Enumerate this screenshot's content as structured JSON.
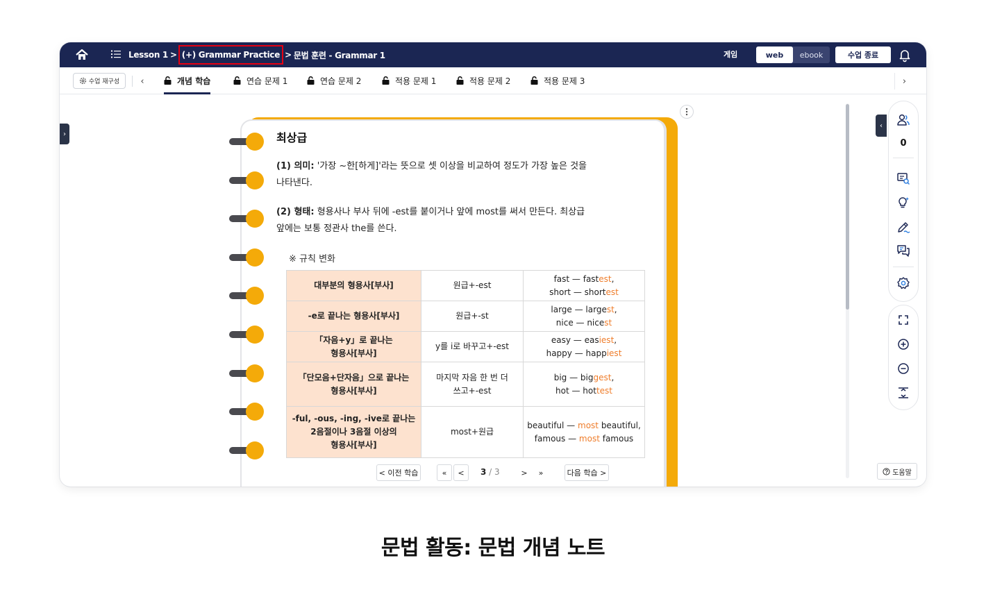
{
  "topbar": {
    "breadcrumb": {
      "lesson": "Lesson 1",
      "sep1": ">",
      "practice": "(+) Grammar Practice",
      "sep2": ">",
      "current": "문법 훈련 - Grammar 1"
    },
    "game_label": "게임",
    "mode_web": "web",
    "mode_ebook": "ebook",
    "end_class": "수업 종료",
    "colors": {
      "bar": "#1b2653",
      "highlight": "#e60012"
    }
  },
  "tabs": {
    "reconfigure": "수업 재구성",
    "items": [
      {
        "label": "개념 학습",
        "active": true
      },
      {
        "label": "연습 문제 1"
      },
      {
        "label": "연습 문제 2"
      },
      {
        "label": "적용 문제 1"
      },
      {
        "label": "적용 문제 2"
      },
      {
        "label": "적용 문제 3"
      }
    ]
  },
  "note": {
    "title": "최상급",
    "p1": {
      "label": "(1) 의미:",
      "text": " '가장 ~한[하게]'라는 뜻으로 셋 이상을 비교하여 정도가 가장 높은 것을",
      "text2": "나타낸다."
    },
    "p2": {
      "label": "(2) 형태:",
      "text": " 형용사나 부사 뒤에 -est를 붙이거나 앞에 most를 써서 만든다. 최상급",
      "text2": "앞에는 보통 정관사 the를 쓴다."
    },
    "rule_heading": "※ 규칙 변화",
    "rows": [
      {
        "kind": "대부분의 형용사[부사]",
        "method": "원급+-est",
        "ex1": {
          "base": "fast — fast",
          "suffix": "est",
          "tail": ","
        },
        "ex2": {
          "base": "short — short",
          "suffix": "est",
          "tail": ""
        }
      },
      {
        "kind": "-e로 끝나는 형용사[부사]",
        "method": "원급+-st",
        "ex1": {
          "base": "large — large",
          "suffix": "st",
          "tail": ","
        },
        "ex2": {
          "base": "nice — nice",
          "suffix": "st",
          "tail": ""
        }
      },
      {
        "kind1": "「자음+y」로 끝나는",
        "kind2": "형용사[부사]",
        "method": "y를 i로 바꾸고+-est",
        "ex1": {
          "base": "easy — eas",
          "suffix": "iest",
          "tail": ","
        },
        "ex2": {
          "base": "happy — happ",
          "suffix": "iest",
          "tail": ""
        }
      },
      {
        "kind1": "「단모음+단자음」으로 끝나는",
        "kind2": "형용사[부사]",
        "method1": "마지막 자음 한 번 더",
        "method2": "쓰고+-est",
        "ex1": {
          "base": "big — big",
          "suffix": "gest",
          "tail": ","
        },
        "ex2": {
          "base": "hot — hot",
          "suffix": "test",
          "tail": ""
        }
      },
      {
        "kind1": "-ful, -ous, -ing, -ive로 끝나는",
        "kind2": "2음절이나 3음절 이상의",
        "kind3": "형용사[부사]",
        "method": "most+원급",
        "ex1": {
          "base": "beautiful — ",
          "suffix": "most",
          "tail": " beautiful,"
        },
        "ex2": {
          "base": "famous — ",
          "suffix": "most",
          "tail": " famous"
        }
      }
    ],
    "colors": {
      "accent": "#f4aa09",
      "key_cell": "#fde2cf",
      "suffix": "#ef7d2b"
    }
  },
  "pager": {
    "prev": "< 이전 학습",
    "first": "«",
    "back": "<",
    "current": "3",
    "slash": " / ",
    "total": "3",
    "forward": ">",
    "last": "»",
    "next": "다음 학습 >"
  },
  "right_toolbar": {
    "participants_count": "0",
    "help": "도움말",
    "icons": [
      "users-icon",
      "screen-search-icon",
      "lightbulb-icon",
      "pen-icon",
      "chat-icon",
      "settings-icon",
      "fullscreen-icon",
      "zoom-in-icon",
      "zoom-out-icon",
      "fit-height-icon"
    ]
  },
  "caption": "문법 활동: 문법 개념 노트"
}
